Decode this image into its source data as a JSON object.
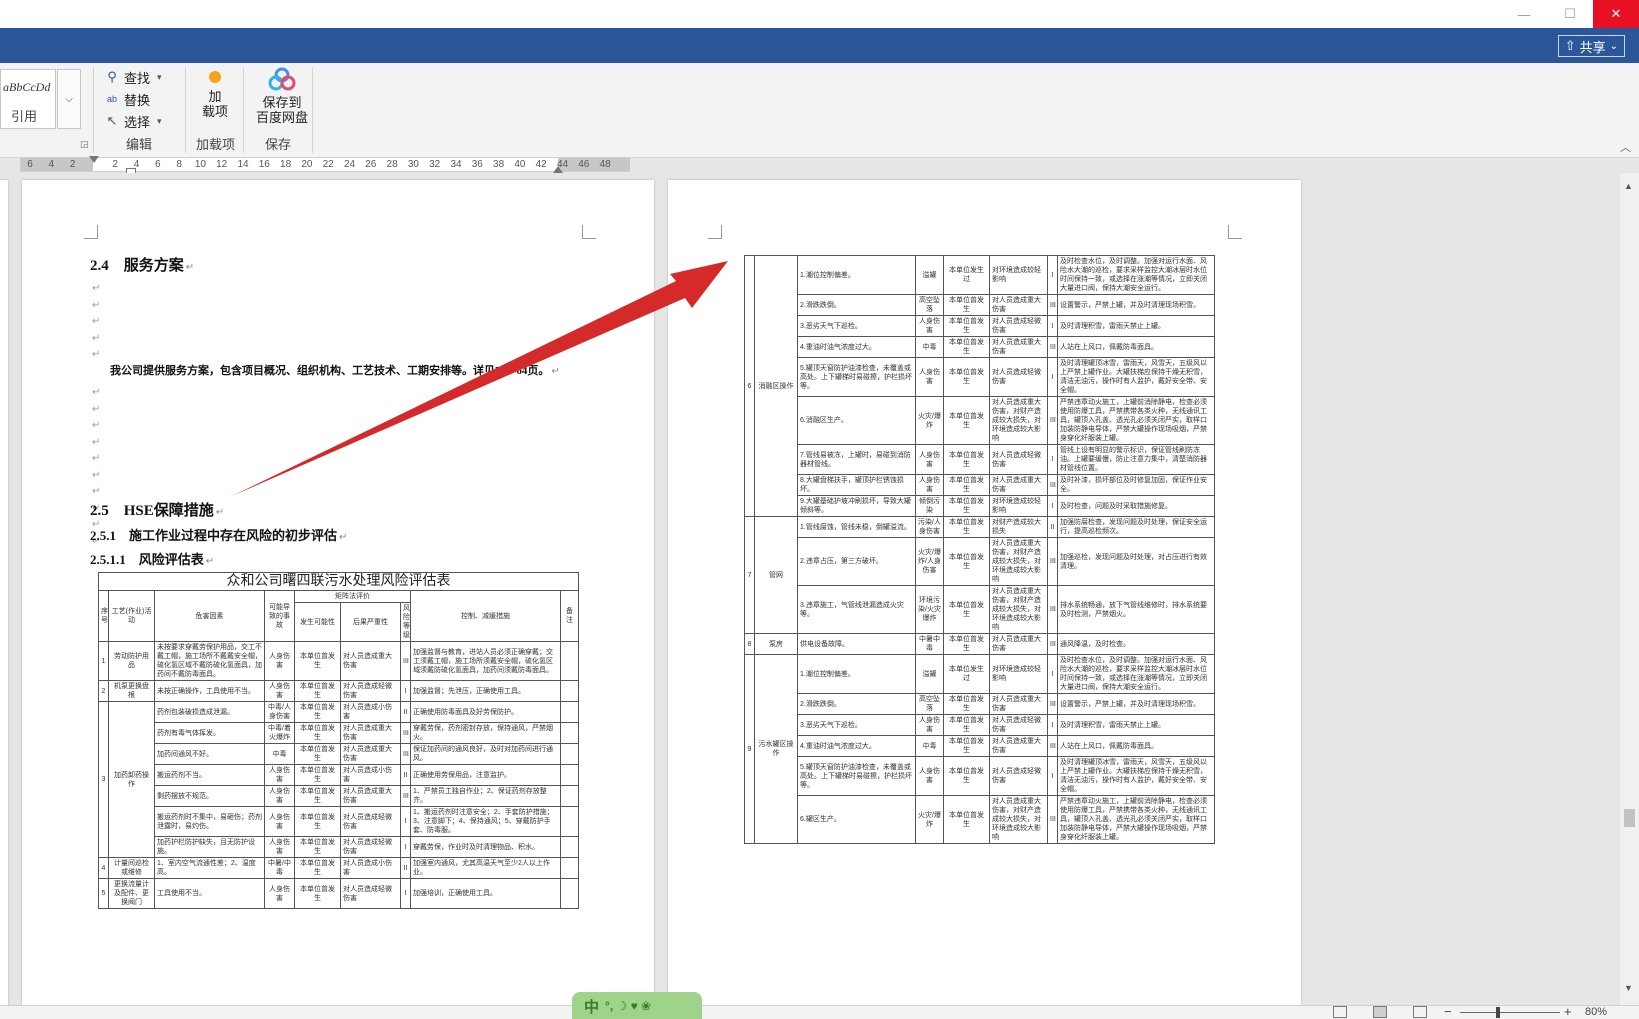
{
  "titlebar": {
    "minimize": "—",
    "maximize": "☐",
    "close": "✕"
  },
  "tabstrip": {
    "share_label": "共享",
    "share_caret": "⌄"
  },
  "ribbon": {
    "style_sample": "aBbCcDd",
    "style_name": "引用",
    "editing": {
      "find_label": "查找",
      "replace_label": "替换",
      "select_label": "选择",
      "group_label": "编辑"
    },
    "addins": {
      "button_line1": "加",
      "button_line2": "载项",
      "group_label": "加载项"
    },
    "save": {
      "button_line1": "保存到",
      "button_line2": "百度网盘",
      "group_label": "保存"
    }
  },
  "ruler": {
    "ticks": [
      "6",
      "4",
      "2",
      "",
      "2",
      "4",
      "6",
      "8",
      "10",
      "12",
      "14",
      "16",
      "18",
      "20",
      "22",
      "24",
      "26",
      "28",
      "30",
      "32",
      "34",
      "36",
      "38",
      "40",
      "42",
      "44",
      "46",
      "48"
    ]
  },
  "document": {
    "h24": "2.4　服务方案",
    "service_text": "我公司提供服务方案，包含项目概况、组织机构、工艺技术、工期安排等。详见P20-64页。",
    "h25": "2.5　HSE保障措施",
    "h251": "2.5.1　施工作业过程中存在风险的初步评估",
    "h2511": "2.5.1.1　风险评估表",
    "para_mark": "↵"
  },
  "left_table": {
    "title": "众和公司曙四联污水处理风险评估表",
    "headers": {
      "no": "序号",
      "process": "工艺(作业)活动",
      "hazard": "危害因素",
      "event": "可能导致的事故",
      "eval": "矩阵法评价",
      "likelihood": "发生可能性",
      "severity": "后果严重性",
      "level": "风险等级",
      "control": "控制、减缓措施",
      "remark": "备注"
    },
    "rows": [
      {
        "no": "1",
        "process": "劳动防护用品",
        "hazard": "未按要求穿戴劳保护用品，交工不戴工帽，施工场所不戴戴安全帽，硫化氢区域不戴防硫化氢面具，加药间不戴防毒面具。",
        "event": "人身伤害",
        "likelihood": "本单位曾发生",
        "severity": "对人员造成重大伤害",
        "level": "III",
        "control": "加强监督与教育，进站人员必须正确穿戴；交工须戴工帽，施工场所须戴安全帽，硫化氢区域须戴防硫化氢面具，加药间须戴防毒面具。"
      },
      {
        "no": "2",
        "process": "机泵更换盘根",
        "hazard": "未按正确操作，工具使用不当。",
        "event": "人身伤害",
        "likelihood": "本单位曾发生",
        "severity": "对人员造成轻微伤害",
        "level": "I",
        "control": "加强监督；先泄压，正确使用工具。"
      },
      {
        "no": "3",
        "process": "加药卸药操作",
        "hazard": "药剂包装破损造成泄漏。",
        "event": "中毒/人身伤害",
        "likelihood": "本单位曾发生",
        "severity": "对人员造成小伤害",
        "level": "II",
        "control": "正确使用防毒面具及好劳保防护。"
      },
      {
        "no": "",
        "process": "",
        "hazard": "药剂有毒气体挥发。",
        "event": "中毒/着火爆炸",
        "likelihood": "本单位曾发生",
        "severity": "对人员造成重大伤害",
        "level": "III",
        "control": "穿戴劳保，药剂密封存放，保持通风，严禁烟火。"
      },
      {
        "no": "",
        "process": "",
        "hazard": "加药间通风不好。",
        "event": "中毒",
        "likelihood": "本单位曾发生",
        "severity": "对人员造成重大伤害",
        "level": "III",
        "control": "保证加药间的通风良好，及时对加药间进行通风。"
      },
      {
        "no": "",
        "process": "",
        "hazard": "搬运药剂不当。",
        "event": "人身伤害",
        "likelihood": "本单位曾发生",
        "severity": "对人员造成小伤害",
        "level": "II",
        "control": "正确使用劳保用品，注意监护。"
      },
      {
        "no": "",
        "process": "",
        "hazard": "剩药摆放不规范。",
        "event": "人身伤害",
        "likelihood": "本单位曾发生",
        "severity": "对人员造成重大伤害",
        "level": "III",
        "control": "1、严禁员工独自作业；2、保证药剂存放整齐。"
      },
      {
        "no": "",
        "process": "",
        "hazard": "搬运药剂时不集中，易砸伤；药剂泄露时，易灼伤。",
        "event": "人身伤害",
        "likelihood": "本单位曾发生",
        "severity": "对人员造成轻微伤害",
        "level": "I",
        "control": "1、搬运药剂时注意安全；2、手套防护措施；3、注意脚下；4、保持通风；5、穿戴防护手套、防毒服。"
      },
      {
        "no": "",
        "process": "",
        "hazard": "加药护栏防护缺失，且无防护设施。",
        "event": "人身伤害",
        "likelihood": "本单位曾发生",
        "severity": "对人员造成轻微伤害",
        "level": "I",
        "control": "穿戴劳保，作业时及时清理物品、积水。"
      },
      {
        "no": "4",
        "process": "计量间巡检或维修",
        "hazard": "1、室内空气流通性差；2、温度高。",
        "event": "中暑/中毒",
        "likelihood": "本单位曾发生",
        "severity": "对人员造成小伤害",
        "level": "II",
        "control": "加强室内通风，尤其高温天气至少2人以上作业。"
      },
      {
        "no": "5",
        "process": "更换流量计及配件、更换阀门",
        "hazard": "工具使用不当。",
        "event": "人身伤害",
        "likelihood": "本单位曾发生",
        "severity": "对人员造成轻微伤害",
        "level": "I",
        "control": "加强培训，正确使用工具。"
      }
    ]
  },
  "right_table": {
    "rows": [
      {
        "group": "6",
        "sub": "消融区操作",
        "item": "1.潮位控制偏差。",
        "cause": "溢罐",
        "prob": "本单位发生过",
        "effect": "对环境造成较轻影响",
        "lvl": "I",
        "measure": "及时检查水位，及时调整。加强对运行水面、风险水大潮的巡检，要求采样监控大潮冰层时水位时间保持一致，或选择在涨潮等情况，立即关闭大量进口阀，保持大潮安全运行。"
      },
      {
        "group": "",
        "sub": "",
        "item": "2.滑跌跌倒。",
        "cause": "高空坠落",
        "prob": "本单位曾发生",
        "effect": "对人员造成重大伤害",
        "lvl": "III",
        "measure": "设置警示，严禁上罐，并及时清理现场积雪。"
      },
      {
        "group": "",
        "sub": "",
        "item": "3.恶劣天气下巡检。",
        "cause": "人身伤害",
        "prob": "本单位曾发生",
        "effect": "对人员造成轻微伤害",
        "lvl": "I",
        "measure": "及时清理积雪，雷雨天禁止上罐。"
      },
      {
        "group": "",
        "sub": "",
        "item": "4.重油时油气浓度过大。",
        "cause": "中毒",
        "prob": "本单位曾发生",
        "effect": "对人员造成重大伤害",
        "lvl": "III",
        "measure": "人站在上风口，佩戴防毒面具。"
      },
      {
        "group": "",
        "sub": "",
        "item": "5.罐顶天窗防护油漆检查，未覆盖或高处。上下罐梯时易碰擦，护栏损坏等。",
        "cause": "人身伤害",
        "prob": "本单位曾发生",
        "effect": "对人员造成轻微伤害",
        "lvl": "I",
        "measure": "及时清理罐顶冰雪，雷雨天，风雪天，五级风以上严禁上罐作业。大罐扶梯应保持干燥无积雪，清洁无油污，操作时有人监护，戴好安全带、安全帽。"
      },
      {
        "group": "",
        "sub": "",
        "item": "6.消融区生产。",
        "cause": "火灾/爆炸",
        "prob": "本单位曾发生",
        "effect": "对人员造成重大伤害，对财产造成较大损失，对环境造成较大影响",
        "lvl": "III",
        "measure": "严禁违章动火施工，上罐前消除静电，检查必须使用防爆工具，严禁携带各类火种，无线通讯工具，罐顶入孔盖、透光孔必须关闭严实，取样口加装防静电导体，严禁大罐操作现场吸烟，严禁身穿化纤服装上罐。"
      },
      {
        "group": "",
        "sub": "",
        "item": "7.管线易被冻，上罐时，易碰到消防器材管线。",
        "cause": "人身伤害",
        "prob": "本单位曾发生",
        "effect": "对人员造成轻微伤害",
        "lvl": "I",
        "measure": "管线上设有明显的警示标识，保证管线刷防冻油。上罐要缓慢，防止注意力集中，清楚消防器材管线位置。"
      },
      {
        "group": "",
        "sub": "",
        "item": "8.大罐盘梯扶手，罐顶护栏锈蚀损坏。",
        "cause": "人身伤害",
        "prob": "本单位曾发生",
        "effect": "对人员造成重大伤害",
        "lvl": "III",
        "measure": "及时补漆，损坏部位及时修复加固，保证作业安全。"
      },
      {
        "group": "",
        "sub": "",
        "item": "9.大罐基础护坡冲刷损坏，导致大罐倾斜等。",
        "cause": "倾倒污染",
        "prob": "本单位曾发生",
        "effect": "对环境造成较轻影响",
        "lvl": "I",
        "measure": "及时检查，问题及时采取措施修复。"
      },
      {
        "group": "7",
        "sub": "管网",
        "item": "1.管线腐蚀，管线未稳，倒罐溢流。",
        "cause": "污染/人身伤害",
        "prob": "本单位曾发生",
        "effect": "对财产造成较大损失",
        "lvl": "II",
        "measure": "加强防腐检查，发现问题及时处理，保证安全运行，提高巡检频次。"
      },
      {
        "group": "",
        "sub": "",
        "item": "2.违章占压，第三方破坏。",
        "cause": "火灾/爆炸/人身伤害",
        "prob": "本单位曾发生",
        "effect": "对人员造成重大伤害，对财产造成较大损失，对环境造成较大影响",
        "lvl": "III",
        "measure": "加强巡检，发现问题及时处理，对占压进行有效清理。"
      },
      {
        "group": "",
        "sub": "",
        "item": "3.违章施工，气管线泄漏造成火灾等。",
        "cause": "环境污染/火灾爆炸",
        "prob": "本单位曾发生",
        "effect": "对人员造成重大伤害，对财产造成较大损失，对环境造成较大影响",
        "lvl": "III",
        "measure": "排水系统畅通，放下气管线维修时，排水系统要及时检测，严禁烟火。"
      },
      {
        "group": "8",
        "sub": "泵房",
        "item": "供电设备故障。",
        "cause": "中暑中毒",
        "prob": "本单位曾发生",
        "effect": "对人员造成重大伤害",
        "lvl": "III",
        "measure": "通风降温，及时检查。"
      },
      {
        "group": "9",
        "sub": "污水罐区操作",
        "item": "1.潮位控制偏差。",
        "cause": "溢罐",
        "prob": "本单位发生过",
        "effect": "对环境造成较轻影响",
        "lvl": "I",
        "measure": "及时检查水位，及时调整。加强对运行水面、风险水大潮的巡检，要求采样监控大潮冰层时水位时间保持一致，或选择在涨潮等情况，立即关闭大量进口阀，保持大潮安全运行。"
      },
      {
        "group": "",
        "sub": "",
        "item": "2.滑跌跌倒。",
        "cause": "高空坠落",
        "prob": "本单位曾发生",
        "effect": "对人员造成重大伤害",
        "lvl": "III",
        "measure": "设置警示，严禁上罐，并及时清理现场积雪。"
      },
      {
        "group": "",
        "sub": "",
        "item": "3.恶劣天气下巡检。",
        "cause": "人身伤害",
        "prob": "本单位曾发生",
        "effect": "对人员造成轻微伤害",
        "lvl": "I",
        "measure": "及时清理积雪，雷雨天禁止上罐。"
      },
      {
        "group": "",
        "sub": "",
        "item": "4.重油时油气浓度过大。",
        "cause": "中毒",
        "prob": "本单位曾发生",
        "effect": "对人员造成重大伤害",
        "lvl": "III",
        "measure": "人站在上风口，佩戴防毒面具。"
      },
      {
        "group": "",
        "sub": "",
        "item": "5.罐顶天窗防护油漆检查，未覆盖或高处。上下罐梯时易碰擦，护栏损坏等。",
        "cause": "人身伤害",
        "prob": "本单位曾发生",
        "effect": "对人员造成轻微伤害",
        "lvl": "I",
        "measure": "及时清理罐顶冰雪，雷雨天，风雪天，五级风以上严禁上罐作业。大罐扶梯应保持干燥无积雪，清洁无油污，操作时有人监护，戴好安全带、安全帽。"
      },
      {
        "group": "",
        "sub": "",
        "item": "6.罐区生产。",
        "cause": "火灾/爆炸",
        "prob": "本单位曾发生",
        "effect": "对人员造成重大伤害，对财产造成较大损失，对环境造成较大影响",
        "lvl": "III",
        "measure": "严禁违章动火施工，上罐前消除静电，检查必须使用防爆工具，严禁携带各类火种，无线通讯工具，罐顶入孔盖、透光孔必须关闭严实，取样口加装防静电导体，严禁大罐操作现场吸烟，严禁身穿化纤服装上罐。"
      }
    ]
  },
  "statusbar": {
    "ime_label": "中",
    "ime_icons": "°, ☽ ♥ ❀",
    "zoom_minus": "−",
    "zoom_plus": "+",
    "zoom_level": "80%"
  },
  "colors": {
    "accent": "#2b579a",
    "arrow": "#d42a2a",
    "ime": "#9fd28a"
  }
}
